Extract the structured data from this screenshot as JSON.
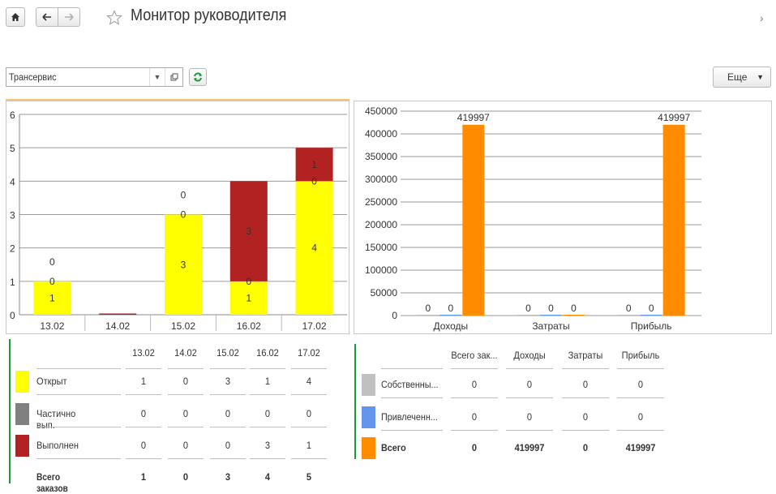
{
  "header": {
    "title": "Монитор руководителя",
    "home_icon": "home-icon",
    "back_icon": "arrow-left-icon",
    "forward_icon": "arrow-right-icon",
    "favorite_icon": "star-icon",
    "more_glyph": "›"
  },
  "toolbar": {
    "organization": "Трансервис",
    "more_label": "Еще",
    "refresh_icon": "refresh-icon"
  },
  "colors": {
    "open": "#ffff00",
    "partial": "#808080",
    "done": "#b22222",
    "own": "#c0c0c0",
    "borrowed": "#6495ed",
    "total": "#ff8c00",
    "accent_green": "#1a9a3a"
  },
  "chart_data": [
    {
      "type": "bar",
      "stacked": true,
      "categories": [
        "13.02",
        "14.02",
        "15.02",
        "16.02",
        "17.02"
      ],
      "series": [
        {
          "name": "Открыт",
          "values": [
            1,
            0,
            3,
            1,
            4
          ]
        },
        {
          "name": "Частично вып.",
          "values": [
            0,
            0,
            0,
            0,
            0
          ]
        },
        {
          "name": "Выполнен",
          "values": [
            0,
            0,
            0,
            3,
            1
          ]
        }
      ],
      "ylim": [
        0,
        6
      ],
      "yticks": [
        0,
        1,
        2,
        3,
        4,
        5,
        6
      ],
      "grid": true
    },
    {
      "type": "bar",
      "categories": [
        "Доходы",
        "Затраты",
        "Прибыль"
      ],
      "series": [
        {
          "name": "Собственны...",
          "values": [
            0,
            0,
            0
          ]
        },
        {
          "name": "Привлеченн...",
          "values": [
            0,
            0,
            0
          ]
        },
        {
          "name": "Всего",
          "values": [
            419997,
            0,
            419997
          ]
        }
      ],
      "ylim": [
        0,
        450000
      ],
      "yticks": [
        0,
        50000,
        100000,
        150000,
        200000,
        250000,
        300000,
        350000,
        400000,
        450000
      ],
      "grid": true
    }
  ],
  "orders_table": {
    "columns": [
      "13.02",
      "14.02",
      "15.02",
      "16.02",
      "17.02"
    ],
    "rows": [
      {
        "label": "Открыт",
        "values": [
          "1",
          "0",
          "3",
          "1",
          "4"
        ]
      },
      {
        "label": "Частично вып.",
        "values": [
          "0",
          "0",
          "0",
          "0",
          "0"
        ]
      },
      {
        "label": "Выполнен",
        "values": [
          "0",
          "0",
          "0",
          "3",
          "1"
        ]
      }
    ],
    "total": {
      "label": "Всего заказов",
      "values": [
        "1",
        "0",
        "3",
        "4",
        "5"
      ]
    }
  },
  "finance_table": {
    "columns": [
      "Всего зак...",
      "Доходы",
      "Затраты",
      "Прибыль"
    ],
    "rows": [
      {
        "label": "Собственны...",
        "values": [
          "0",
          "0",
          "0",
          "0"
        ]
      },
      {
        "label": "Привлеченн...",
        "values": [
          "0",
          "0",
          "0",
          "0"
        ]
      },
      {
        "label": "Всего",
        "values": [
          "0",
          "419997",
          "0",
          "419997"
        ]
      }
    ]
  }
}
